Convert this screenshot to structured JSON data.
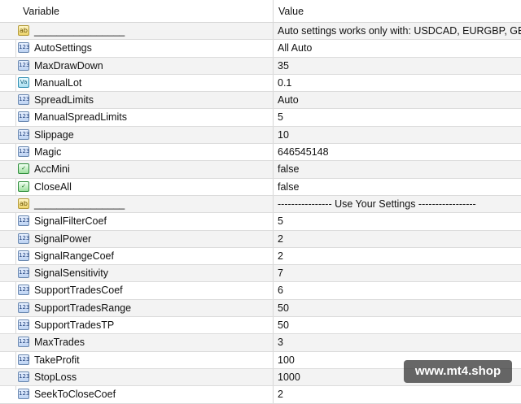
{
  "table": {
    "header": {
      "variable": "Variable",
      "value": "Value"
    },
    "rows": [
      {
        "icon": "string-icon",
        "name": "________________",
        "value": "Auto settings works only with: USDCAD, EURGBP, GB...",
        "type": "ab"
      },
      {
        "icon": "integer-icon",
        "name": "AutoSettings",
        "value": "All Auto",
        "type": "int"
      },
      {
        "icon": "integer-icon",
        "name": "MaxDrawDown",
        "value": "35",
        "type": "int"
      },
      {
        "icon": "double-icon",
        "name": "ManualLot",
        "value": "0.1",
        "type": "dbl"
      },
      {
        "icon": "integer-icon",
        "name": "SpreadLimits",
        "value": "Auto",
        "type": "int"
      },
      {
        "icon": "integer-icon",
        "name": "ManualSpreadLimits",
        "value": "5",
        "type": "int"
      },
      {
        "icon": "integer-icon",
        "name": "Slippage",
        "value": "10",
        "type": "int"
      },
      {
        "icon": "integer-icon",
        "name": "Magic",
        "value": "646545148",
        "type": "int"
      },
      {
        "icon": "boolean-icon",
        "name": "AccMini",
        "value": "false",
        "type": "bool"
      },
      {
        "icon": "boolean-icon",
        "name": "CloseAll",
        "value": "false",
        "type": "bool"
      },
      {
        "icon": "string-icon",
        "name": "________________",
        "value": "----------------  Use Your Settings  -----------------",
        "type": "ab"
      },
      {
        "icon": "integer-icon",
        "name": "SignalFilterCoef",
        "value": "5",
        "type": "int"
      },
      {
        "icon": "integer-icon",
        "name": "SignalPower",
        "value": "2",
        "type": "int"
      },
      {
        "icon": "integer-icon",
        "name": "SignalRangeCoef",
        "value": "2",
        "type": "int"
      },
      {
        "icon": "integer-icon",
        "name": "SignalSensitivity",
        "value": "7",
        "type": "int"
      },
      {
        "icon": "integer-icon",
        "name": "SupportTradesCoef",
        "value": "6",
        "type": "int"
      },
      {
        "icon": "integer-icon",
        "name": "SupportTradesRange",
        "value": "50",
        "type": "int"
      },
      {
        "icon": "integer-icon",
        "name": "SupportTradesTP",
        "value": "50",
        "type": "int"
      },
      {
        "icon": "integer-icon",
        "name": "MaxTrades",
        "value": "3",
        "type": "int"
      },
      {
        "icon": "integer-icon",
        "name": "TakeProfit",
        "value": "100",
        "type": "int"
      },
      {
        "icon": "integer-icon",
        "name": "StopLoss",
        "value": "1000",
        "type": "int"
      },
      {
        "icon": "integer-icon",
        "name": "SeekToCloseCoef",
        "value": "2",
        "type": "int"
      }
    ]
  },
  "watermark": "www.mt4.shop",
  "icon_text": {
    "int": "123",
    "dbl": "Va",
    "bool": "✓",
    "ab": "ab"
  }
}
